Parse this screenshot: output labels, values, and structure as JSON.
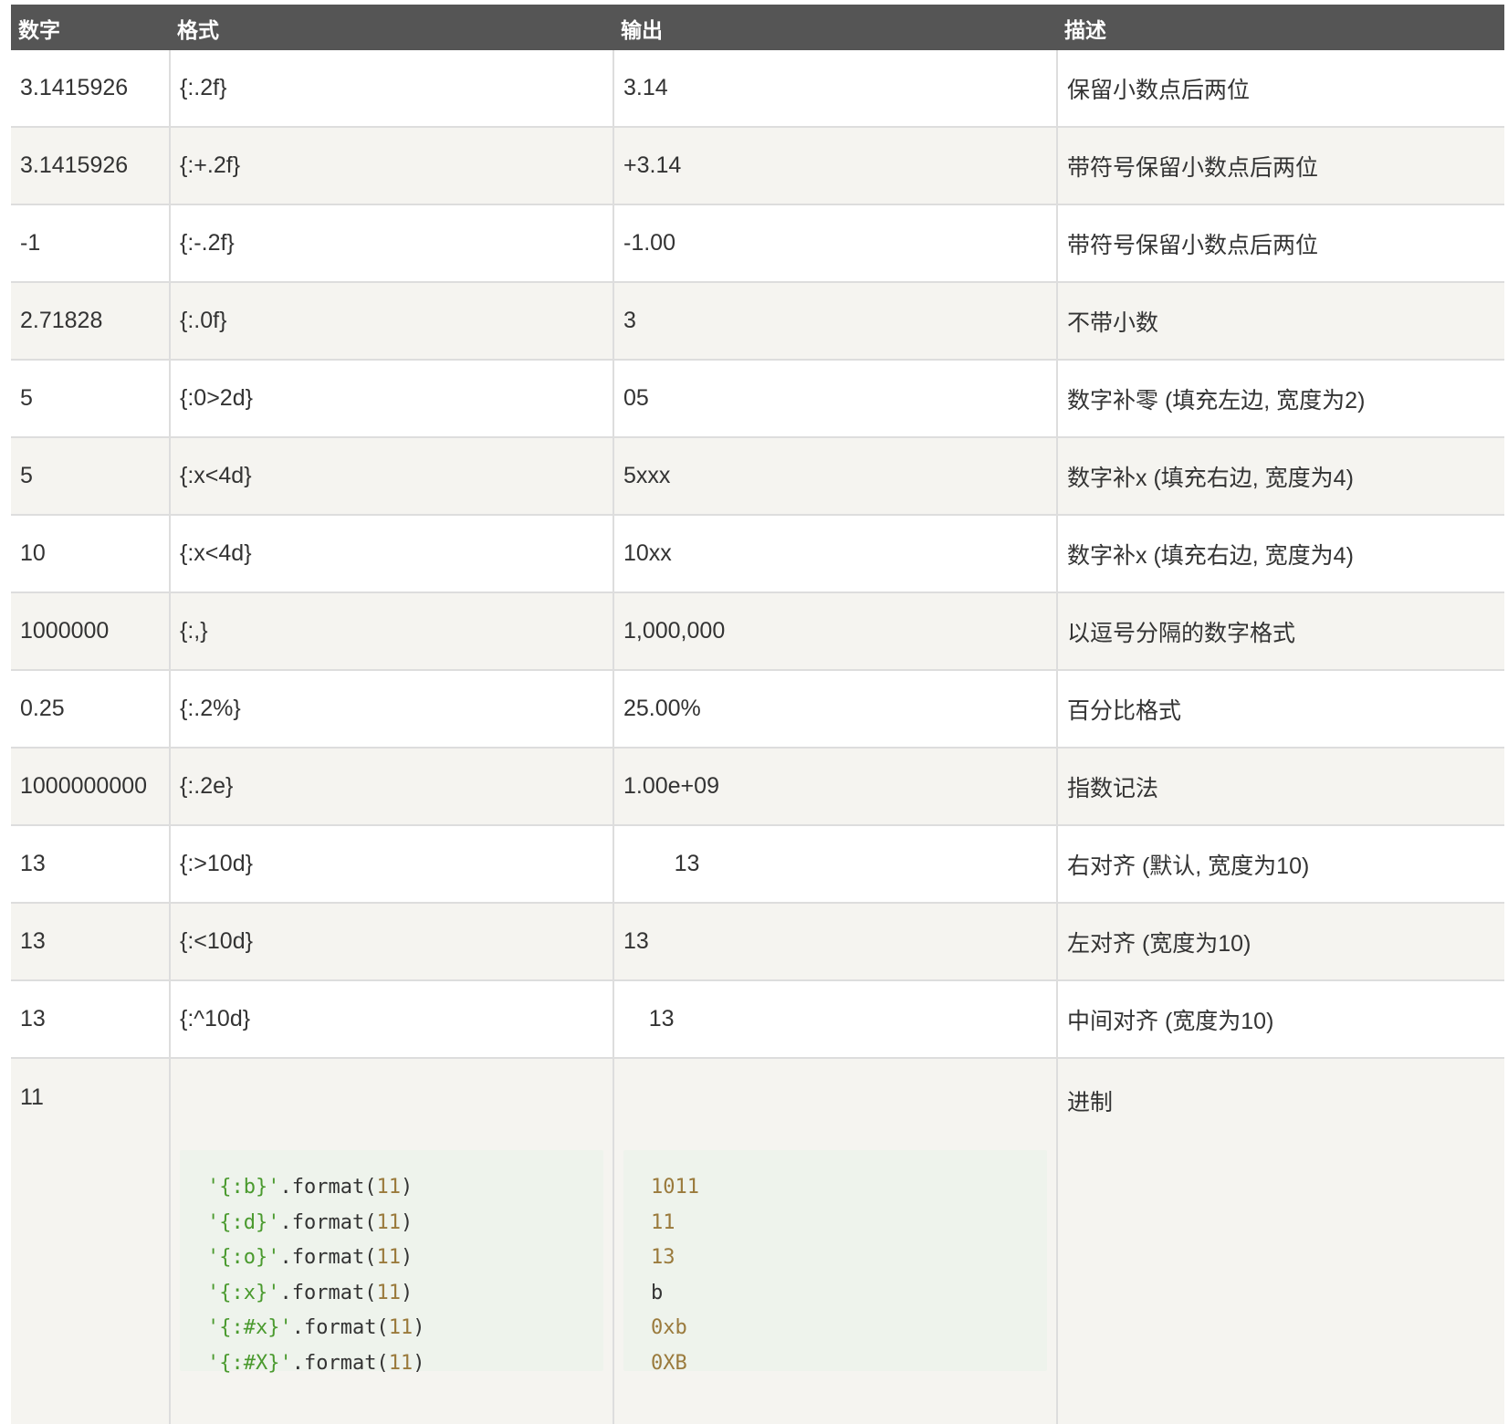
{
  "table": {
    "headers": [
      "数字",
      "格式",
      "输出",
      "描述"
    ],
    "rows": [
      [
        "3.1415926",
        "{:.2f}",
        "3.14",
        "保留小数点后两位"
      ],
      [
        "3.1415926",
        "{:+.2f}",
        "+3.14",
        "带符号保留小数点后两位"
      ],
      [
        "-1",
        "{:-.2f}",
        "-1.00",
        "带符号保留小数点后两位"
      ],
      [
        "2.71828",
        "{:.0f}",
        "3",
        "不带小数"
      ],
      [
        "5",
        "{:0>2d}",
        "05",
        "数字补零 (填充左边, 宽度为2)"
      ],
      [
        "5",
        "{:x<4d}",
        "5xxx",
        "数字补x (填充右边, 宽度为4)"
      ],
      [
        "10",
        "{:x<4d}",
        "10xx",
        "数字补x (填充右边, 宽度为4)"
      ],
      [
        "1000000",
        "{:,}",
        "1,000,000",
        "以逗号分隔的数字格式"
      ],
      [
        "0.25",
        "{:.2%}",
        "25.00%",
        "百分比格式"
      ],
      [
        "1000000000",
        "{:.2e}",
        "1.00e+09",
        "指数记法"
      ],
      [
        "13",
        "{:>10d}",
        "        13",
        "右对齐 (默认, 宽度为10)"
      ],
      [
        "13",
        "{:<10d}",
        "13",
        "左对齐 (宽度为10)"
      ],
      [
        "13",
        "{:^10d}",
        "    13",
        "中间对齐 (宽度为10)"
      ]
    ],
    "last_row": {
      "number": "11",
      "description": "进制",
      "code_lines": [
        {
          "str": "'{:b}'",
          "fn": ".format(",
          "num": "11",
          "close": ")"
        },
        {
          "str": "'{:d}'",
          "fn": ".format(",
          "num": "11",
          "close": ")"
        },
        {
          "str": "'{:o}'",
          "fn": ".format(",
          "num": "11",
          "close": ")"
        },
        {
          "str": "'{:x}'",
          "fn": ".format(",
          "num": "11",
          "close": ")"
        },
        {
          "str": "'{:#x}'",
          "fn": ".format(",
          "num": "11",
          "close": ")"
        },
        {
          "str": "'{:#X}'",
          "fn": ".format(",
          "num": "11",
          "close": ")"
        }
      ],
      "output_lines": [
        {
          "text": "1011",
          "kind": "num"
        },
        {
          "text": "11",
          "kind": "num"
        },
        {
          "text": "13",
          "kind": "num"
        },
        {
          "text": "b",
          "kind": "txt"
        },
        {
          "text": "0xb",
          "kind": "num"
        },
        {
          "text": "0XB",
          "kind": "num"
        }
      ]
    }
  },
  "colors": {
    "header_bg": "#555555",
    "stripe_bg": "#f5f4f0",
    "code_bg": "#eef3ec",
    "string": "#4a9a2e",
    "number": "#9a7a3c"
  }
}
